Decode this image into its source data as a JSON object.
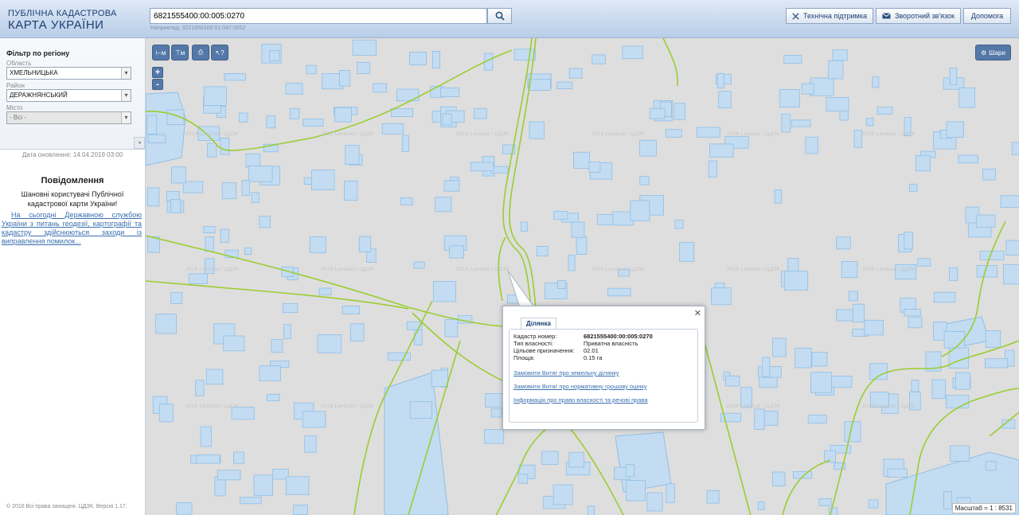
{
  "header": {
    "brand_sub": "ПУБЛІЧНА КАДАСТРОВА",
    "brand_main": "КАРТА УКРАЇНИ",
    "search_value": "6821555400:00:005:0270",
    "search_example": "Наприклад: 3221655100:01:047:0052",
    "support_label": "Технічна підтримка",
    "feedback_label": "Зворотний зв'язок",
    "help_label": "Допомога"
  },
  "sidebar": {
    "filter_title": "Фільтр по регіону",
    "region_label": "Область",
    "region_value": "ХМЕЛЬНИЦЬКА",
    "district_label": "Район",
    "district_value": "ДЕРАЖНЯНСЬКИЙ",
    "city_label": "Місто",
    "city_value": "- Всі -",
    "update_date": "Дата оновлення: 14.04.2019 03:00",
    "notice_title": "Повідомлення",
    "notice_text": "Шановні користувачі Публічної кадастрової карти України!",
    "notice_link": "На сьогодні Державною службою України з питань геодезії, картографії та кадастру здійснюються заходи із виправлення помилок...",
    "copyright": "© 2016 Всі права захищені. ЦДЗК. Версія 1.17."
  },
  "map": {
    "tool_labels": [
      "⊢м",
      "⊤м",
      "⎙",
      "↖?"
    ],
    "zoom_in": "+",
    "zoom_out": "-",
    "layers_label": "Шари",
    "watermark": "2018 Landsat / ЦДЗК",
    "scale": "Масштаб = 1 : 8531",
    "colors": {
      "parcel_fill": "#c3dcf1",
      "parcel_stroke": "#8fbfe6",
      "boundary": "#9acd32",
      "background": "#dedede"
    }
  },
  "popup": {
    "tab": "Ділянка",
    "rows": [
      {
        "key": "Кадастр.номер:",
        "value": "6821555400:00:005:0270"
      },
      {
        "key": "Тип власності:",
        "value": "Приватна власність"
      },
      {
        "key": "Цільове призначення:",
        "value": "02.01"
      },
      {
        "key": "Площа:",
        "value": "0.15 га"
      }
    ],
    "links": [
      "Замовити Витяг про земельну ділянку",
      "Замовити Витяг про нормативну грошову оцінку",
      "Інформація про право власності та речові права"
    ]
  }
}
